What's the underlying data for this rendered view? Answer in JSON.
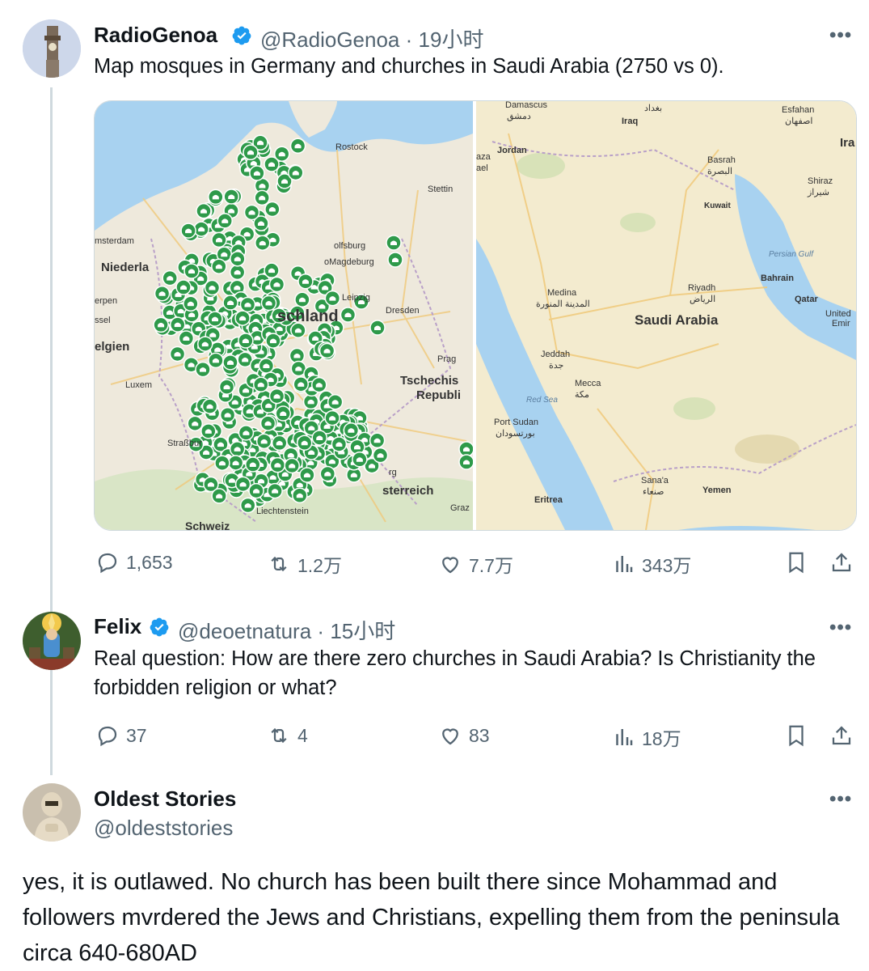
{
  "tweets": [
    {
      "name": "RadioGenoa",
      "handle": "@RadioGenoa",
      "time": "19小时",
      "text": "Map mosques in Germany and churches in Saudi Arabia (2750 vs 0).",
      "stats": {
        "replies": "1,653",
        "retweets": "1.2万",
        "likes": "7.7万",
        "views": "343万"
      }
    },
    {
      "name": "Felix",
      "handle": "@deoetnatura",
      "time": "15小时",
      "text": "Real question: How are there zero churches in Saudi Arabia? Is Christianity the forbidden religion or what?",
      "stats": {
        "replies": "37",
        "retweets": "4",
        "likes": "83",
        "views": "18万"
      }
    }
  ],
  "reply": {
    "name": "Oldest Stories",
    "handle": "@oldeststories",
    "text": "yes, it is outlawed. No church has been built there since Mohammad and followers mvrdered the Jews and Christians, expelling them from the peninsula circa 640-680AD"
  },
  "map_germany": {
    "labels": [
      "Rostock",
      "Stettin",
      "msterdam",
      "Niederla",
      "olfsburg",
      "oMagdeburg",
      "schland",
      "Leipzig",
      "Dresden",
      "erpen",
      "ssel",
      "elgien",
      "Prag",
      "Tschechis",
      "Republi",
      "Luxem",
      "Straßbur",
      "rg",
      "sterreich",
      "Liechtenstein",
      "Graz",
      "Schweiz"
    ]
  },
  "map_saudi": {
    "labels": [
      "Damascus",
      "دمشق",
      "Iraq",
      "بغداد",
      "Esfahan",
      "اصفهان",
      "Ira",
      "Jordan",
      "aza",
      "ael",
      "Basrah",
      "البصرة",
      "Shiraz",
      "شيراز",
      "Kuwait",
      "Persian Gulf",
      "Bahrain",
      "Medina",
      "المدينة المنورة",
      "Riyadh",
      "الرياض",
      "Qatar",
      "United",
      "Emir",
      "Saudi Arabia",
      "Jeddah",
      "جدة",
      "Mecca",
      "مكة",
      "Red Sea",
      "Port Sudan",
      "بورتسودان",
      "Sana'a",
      "صنعاء",
      "Yemen",
      "Eritrea"
    ]
  },
  "colors": {
    "text": "#0f1419",
    "secondary": "#536471",
    "verified": "#1d9bf0",
    "line": "#cfd9de",
    "pin": "#2e9a4a"
  }
}
